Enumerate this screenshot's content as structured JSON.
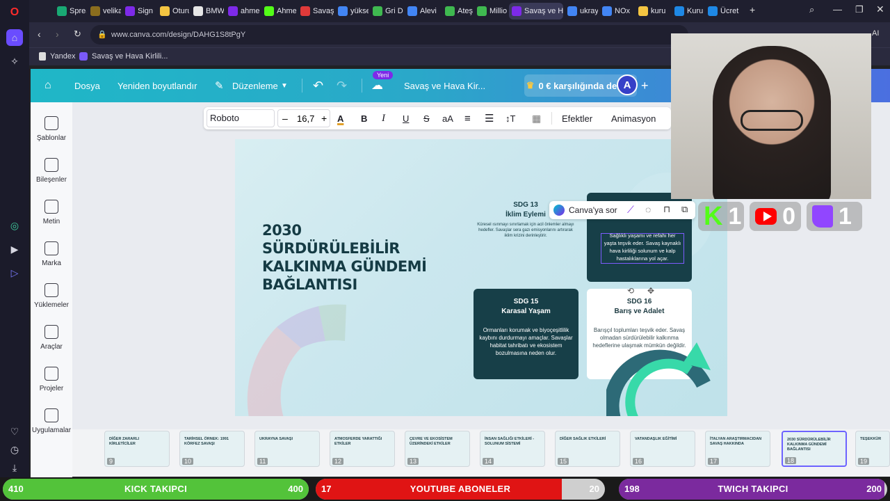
{
  "browser": {
    "tabs": [
      {
        "label": "Sprea"
      },
      {
        "label": "velika"
      },
      {
        "label": "Sign"
      },
      {
        "label": "Oturu"
      },
      {
        "label": "BMW"
      },
      {
        "label": "ahme"
      },
      {
        "label": "Ahme"
      },
      {
        "label": "Savaş"
      },
      {
        "label": "yükse"
      },
      {
        "label": "Gri D"
      },
      {
        "label": "Alevi"
      },
      {
        "label": "Ateş"
      },
      {
        "label": "Millio"
      },
      {
        "label": "Savaş ve H",
        "active": true
      },
      {
        "label": "ukray"
      },
      {
        "label": "NOx"
      },
      {
        "label": "kuru"
      },
      {
        "label": "Kurul"
      },
      {
        "label": "Ücret"
      }
    ],
    "url": "www.canva.com/design/DAHG1S8tPgY",
    "bookmarks": [
      "Yandex",
      "Savaş ve Hava Kirlili..."
    ],
    "ai_label": "AI"
  },
  "canva": {
    "header": {
      "menu_file": "Dosya",
      "menu_resize": "Yeniden boyutlandır",
      "menu_edit": "Düzenleme",
      "new_badge": "Yeni",
      "doc_title": "Savaş ve Hava Kir...",
      "upgrade": "0 € karşılığında dene...",
      "avatar": "A"
    },
    "sidebar": [
      {
        "label": "Şablonlar"
      },
      {
        "label": "Bileşenler"
      },
      {
        "label": "Metin"
      },
      {
        "label": "Marka"
      },
      {
        "label": "Yüklemeler"
      },
      {
        "label": "Araçlar"
      },
      {
        "label": "Projeler"
      },
      {
        "label": "Uygulamalar"
      }
    ],
    "toolbar": {
      "font": "Roboto",
      "size": "16,7",
      "effects": "Efektler",
      "animation": "Animasyon"
    },
    "context_menu": {
      "ask_canva": "Canva'ya sor"
    },
    "slide": {
      "title": "2030 SÜRDÜRÜLEBİLİR KALKINMA GÜNDEMİ BAĞLANTISI",
      "cards": [
        {
          "id": "sdg13",
          "heading": "SDG 13",
          "subheading": "İklim Eylemi",
          "body": "Küresel ısınmayı sınırlamak için acil önlemler almayı hedefler. Savaşlar sera gazı emisyonlarını artırarak iklim krizini derinleştirir."
        },
        {
          "id": "sdg3",
          "heading": "",
          "subheading": "",
          "body": "Sağlıklı yaşamı ve refahı her yaşta teşvik eder. Savaş kaynaklı hava kirliliği solunum ve kalp hastalıklarına yol açar."
        },
        {
          "id": "sdg15",
          "heading": "SDG 15",
          "subheading": "Karasal Yaşam",
          "body": "Ormanları korumak ve biyoçeşitlilik kaybını durdurmayı amaçlar. Savaşlar habitat tahribatı ve ekosistem bozulmasına neden olur."
        },
        {
          "id": "sdg16",
          "heading": "SDG 16",
          "subheading": "Barış ve Adalet",
          "body": "Barışçıl toplumları teşvik eder. Savaş olmadan sürdürülebilir kalkınma hedeflerine ulaşmak mümkün değildir."
        }
      ]
    },
    "pages": [
      {
        "num": "9",
        "title": "DİĞER ZARARLI KİRLETİCİLER"
      },
      {
        "num": "10",
        "title": "TARİHSEL ÖRNEK: 1991 KÖRFEZ SAVAŞI"
      },
      {
        "num": "11",
        "title": "UKRAYNA SAVAŞI"
      },
      {
        "num": "12",
        "title": "ATMOSFERDE YARATTIĞI ETKİLER"
      },
      {
        "num": "13",
        "title": "ÇEVRE VE EKOSİSTEM ÜZERİNDEKİ ETKİLER"
      },
      {
        "num": "14",
        "title": "İNSAN SAĞLIĞI ETKİLERİ - SOLUNUM SİSTEMİ"
      },
      {
        "num": "15",
        "title": "DİĞER SAĞLIK ETKİLERİ"
      },
      {
        "num": "16",
        "title": "VATANDAŞLIK EĞİTİMİ"
      },
      {
        "num": "17",
        "title": "İTALYAN ARAŞTIRMACIDAN SAVAŞ HAKKINDA"
      },
      {
        "num": "18",
        "title": "2030 SÜRDÜRÜLEBİLİR KALKINMA GÜNDEMİ BAĞLANTISI",
        "selected": true
      },
      {
        "num": "19",
        "title": "TEŞEKKÜR"
      }
    ]
  },
  "stream_overlay": {
    "kick_count": "1",
    "youtube_count": "0",
    "twitch_count": "1",
    "bars": [
      {
        "label": "KICK TAKIPCI",
        "current": "410",
        "goal": "400",
        "progress": 1.0,
        "color": "#53c33a"
      },
      {
        "label": "YOUTUBE ABONELER",
        "current": "17",
        "goal": "20",
        "progress": 0.85,
        "color": "#e01414"
      },
      {
        "label": "TWICH TAKIPCI",
        "current": "198",
        "goal": "200",
        "progress": 0.99,
        "color": "#7b2a9e"
      }
    ]
  }
}
